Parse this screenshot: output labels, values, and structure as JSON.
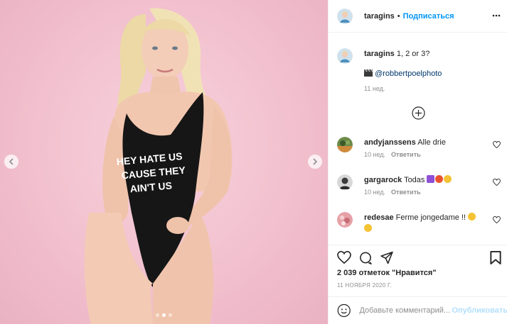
{
  "post": {
    "photo_overlay_text": "HEY HATE US\nCAUSE THEY\nAIN'T US",
    "carousel": {
      "total": 3,
      "active": 2
    }
  },
  "header": {
    "username": "taragins",
    "separator": "•",
    "follow_label": "Подписаться"
  },
  "caption": {
    "username": "taragins",
    "text": "1, 2 or 3?",
    "photo_credit": "@robbertpoelphoto",
    "time": "11 нед."
  },
  "comments": [
    {
      "username": "andyjanssens",
      "text": "Alle drie",
      "time": "10 нед.",
      "reply_label": "Ответить"
    },
    {
      "username": "gargarock",
      "text": "Todas",
      "time": "10 нед.",
      "reply_label": "Ответить"
    },
    {
      "username": "redesae",
      "text": "Ferme jongedame !!",
      "time": "",
      "reply_label": ""
    }
  ],
  "stats": {
    "likes": "2 039 отметок \"Нравится\"",
    "date": "11 НОЯБРЯ 2020 Г."
  },
  "composer": {
    "placeholder": "Добавьте комментарий...",
    "publish_label": "Опубликовать"
  },
  "colors": {
    "accent": "#0095f6",
    "link": "#00376b",
    "muted": "#8e8e8e",
    "photo_background": "#f1c1cf"
  }
}
